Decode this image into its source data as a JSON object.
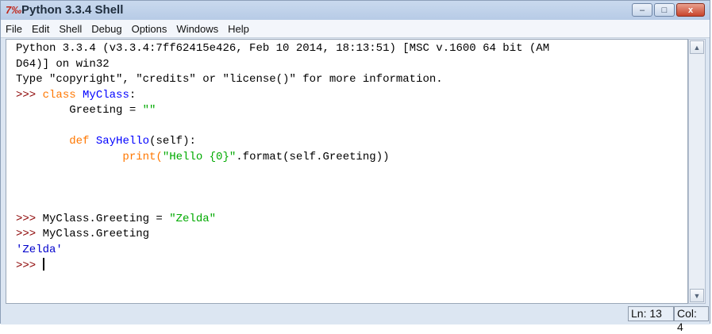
{
  "window": {
    "title": "Python 3.3.4 Shell",
    "icon": "python-idle-icon",
    "controls": {
      "minimize": "–",
      "maximize": "□",
      "close": "x"
    }
  },
  "menubar": [
    "File",
    "Edit",
    "Shell",
    "Debug",
    "Options",
    "Windows",
    "Help"
  ],
  "editor": {
    "banner_line1": "Python 3.3.4 (v3.3.4:7ff62415e426, Feb 10 2014, 18:13:51) [MSC v.1600 64 bit (AM",
    "banner_line2": "D64)] on win32",
    "info_line": "Type \"copyright\", \"credits\" or \"license()\" for more information.",
    "prompt": ">>> ",
    "class_kw": "class",
    "class_name": "MyClass",
    "colon": ":",
    "indent1": "        ",
    "greeting_assign": "Greeting = ",
    "empty_str": "\"\"",
    "def_kw": "def",
    "method_name": "SayHello",
    "method_args": "(self):",
    "indent2": "                ",
    "print_start": "print(",
    "hello_str": "\"Hello {0}\"",
    "print_end": ".format(self.Greeting))",
    "set_stmt": "MyClass.Greeting = ",
    "zelda_str": "\"Zelda\"",
    "get_stmt": "MyClass.Greeting",
    "output": "'Zelda'",
    "final_prompt": ">>> "
  },
  "statusbar": {
    "line": "Ln: 13",
    "col": "Col: 4"
  },
  "colors": {
    "keyword": "#ff7700",
    "definition": "#0000ff",
    "string": "#00aa00",
    "prompt": "#8b0000",
    "output": "#0000cc"
  }
}
